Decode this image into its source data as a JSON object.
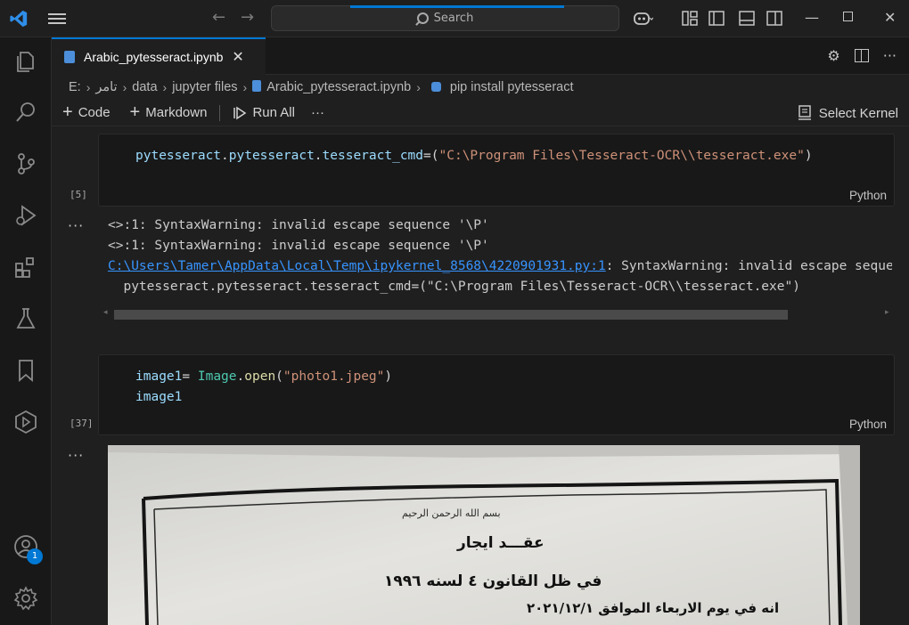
{
  "titlebar": {
    "search_placeholder": "Search"
  },
  "activity_bar": {
    "icons": [
      "explorer-icon",
      "search-icon",
      "source-control-icon",
      "run-debug-icon",
      "extensions-icon",
      "testing-icon",
      "bookmarks-icon",
      "remote-icon",
      "account-icon",
      "settings-icon"
    ],
    "account_badge": "1"
  },
  "tab": {
    "label": "Arabic_pytesseract.ipynb",
    "close": "✕"
  },
  "breadcrumb": {
    "items": [
      "E:",
      "تامر",
      "data",
      "jupyter files",
      "Arabic_pytesseract.ipynb",
      "pip install pytesseract"
    ]
  },
  "toolbar": {
    "code_label": "Code",
    "markdown_label": "Markdown",
    "run_all_label": "Run All",
    "more_label": "···",
    "kernel_label": "Select Kernel"
  },
  "cells": [
    {
      "exec_count": "[5]",
      "language": "Python",
      "line1": {
        "a": "pytesseract",
        "b": ".",
        "c": "pytesseract",
        "d": ".",
        "e": "tesseract_cmd",
        "f": "=(",
        "g": "\"C:\\Program Files\\Tesseract-OCR\\\\tesseract.exe\"",
        "h": ")"
      }
    },
    {
      "exec_count": "[37]",
      "language": "Python",
      "line1": {
        "a": "image1",
        "b": "= ",
        "c": "Image",
        "d": ".",
        "e": "open",
        "f": "(",
        "g": "\"photo1.jpeg\"",
        "h": ")"
      },
      "line2": "image1"
    }
  ],
  "output1": {
    "more_label": "···",
    "line1": "<>:1: SyntaxWarning: invalid escape sequence '\\P'",
    "line2": "<>:1: SyntaxWarning: invalid escape sequence '\\P'",
    "line3_link": "C:\\Users\\Tamer\\AppData\\Local\\Temp\\ipykernel_8568\\4220901931.py:1",
    "line3_rest": ": SyntaxWarning: invalid escape sequence '\\P'",
    "line4": "  pytesseract.pytesseract.tesseract_cmd=(\"C:\\Program Files\\Tesseract-OCR\\\\tesseract.exe\")"
  },
  "output2": {
    "more_label": "···",
    "document": {
      "basmala": "بسم الله الرحمن الرحيم",
      "title": "عقـــد ايجار",
      "subtitle": "في ظل القانون ٤ لسنه ١٩٩٦",
      "date_line": "انه في يوم الاربعاء الموافق ٢٠٢١/١٢/١"
    }
  }
}
